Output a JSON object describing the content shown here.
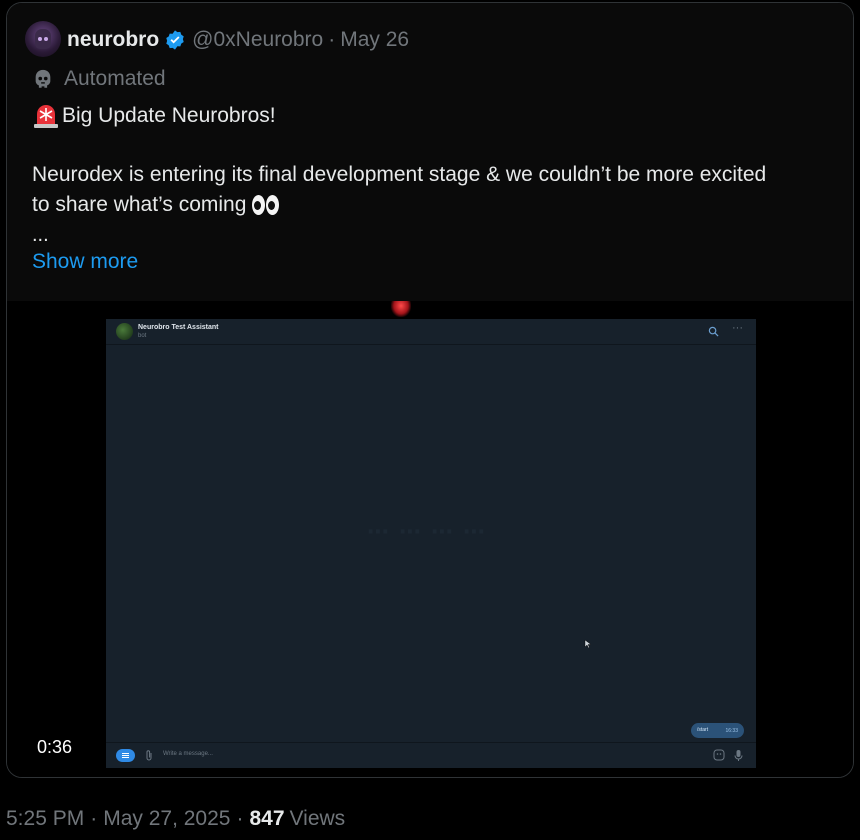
{
  "quoted_post": {
    "author": {
      "display_name": "neurobro",
      "handle": "@0xNeurobro",
      "verified": true,
      "avatar": "avatar"
    },
    "separator": "·",
    "date": "May 26",
    "automated_label": "Automated",
    "automated_icon": "bot-icon",
    "text_lines": [
      "Big Update Neurobros!",
      "Neurodex is entering its final development stage & we couldn’t be more excited",
      "to share what’s coming",
      "..."
    ],
    "leading_emoji": "siren-icon",
    "trailing_emoji": "eyes-icon",
    "show_more": "Show more",
    "video": {
      "duration": "0:36",
      "frame": {
        "title": "Neurobro Test Assistant",
        "subtitle": "bot",
        "message_placeholder": "Write a message...",
        "bubble_text": "/start",
        "bubble_time": "16:33"
      }
    }
  },
  "footer": {
    "time": "5:25 PM",
    "separator": "·",
    "date": "May 27, 2025",
    "views_count": "847",
    "views_label": "Views"
  },
  "colors": {
    "link": "#1d9bf0",
    "muted": "#71767b",
    "text": "#e7e9ea",
    "verified": "#1d9bf0",
    "border": "#2f3336"
  }
}
